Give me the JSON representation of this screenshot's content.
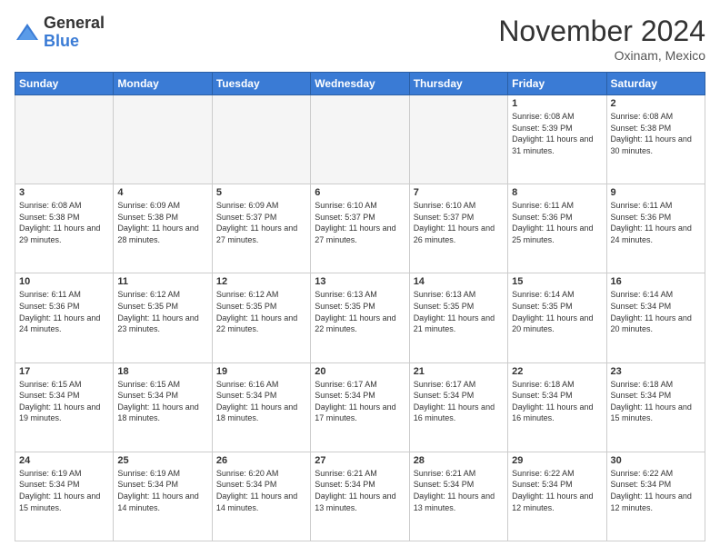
{
  "header": {
    "logo_general": "General",
    "logo_blue": "Blue",
    "month_title": "November 2024",
    "location": "Oxinam, Mexico"
  },
  "weekdays": [
    "Sunday",
    "Monday",
    "Tuesday",
    "Wednesday",
    "Thursday",
    "Friday",
    "Saturday"
  ],
  "weeks": [
    [
      {
        "day": "",
        "empty": true
      },
      {
        "day": "",
        "empty": true
      },
      {
        "day": "",
        "empty": true
      },
      {
        "day": "",
        "empty": true
      },
      {
        "day": "",
        "empty": true
      },
      {
        "day": "1",
        "sunrise": "6:08 AM",
        "sunset": "5:39 PM",
        "daylight": "11 hours and 31 minutes."
      },
      {
        "day": "2",
        "sunrise": "6:08 AM",
        "sunset": "5:38 PM",
        "daylight": "11 hours and 30 minutes."
      }
    ],
    [
      {
        "day": "3",
        "sunrise": "6:08 AM",
        "sunset": "5:38 PM",
        "daylight": "11 hours and 29 minutes."
      },
      {
        "day": "4",
        "sunrise": "6:09 AM",
        "sunset": "5:38 PM",
        "daylight": "11 hours and 28 minutes."
      },
      {
        "day": "5",
        "sunrise": "6:09 AM",
        "sunset": "5:37 PM",
        "daylight": "11 hours and 27 minutes."
      },
      {
        "day": "6",
        "sunrise": "6:10 AM",
        "sunset": "5:37 PM",
        "daylight": "11 hours and 27 minutes."
      },
      {
        "day": "7",
        "sunrise": "6:10 AM",
        "sunset": "5:37 PM",
        "daylight": "11 hours and 26 minutes."
      },
      {
        "day": "8",
        "sunrise": "6:11 AM",
        "sunset": "5:36 PM",
        "daylight": "11 hours and 25 minutes."
      },
      {
        "day": "9",
        "sunrise": "6:11 AM",
        "sunset": "5:36 PM",
        "daylight": "11 hours and 24 minutes."
      }
    ],
    [
      {
        "day": "10",
        "sunrise": "6:11 AM",
        "sunset": "5:36 PM",
        "daylight": "11 hours and 24 minutes."
      },
      {
        "day": "11",
        "sunrise": "6:12 AM",
        "sunset": "5:35 PM",
        "daylight": "11 hours and 23 minutes."
      },
      {
        "day": "12",
        "sunrise": "6:12 AM",
        "sunset": "5:35 PM",
        "daylight": "11 hours and 22 minutes."
      },
      {
        "day": "13",
        "sunrise": "6:13 AM",
        "sunset": "5:35 PM",
        "daylight": "11 hours and 22 minutes."
      },
      {
        "day": "14",
        "sunrise": "6:13 AM",
        "sunset": "5:35 PM",
        "daylight": "11 hours and 21 minutes."
      },
      {
        "day": "15",
        "sunrise": "6:14 AM",
        "sunset": "5:35 PM",
        "daylight": "11 hours and 20 minutes."
      },
      {
        "day": "16",
        "sunrise": "6:14 AM",
        "sunset": "5:34 PM",
        "daylight": "11 hours and 20 minutes."
      }
    ],
    [
      {
        "day": "17",
        "sunrise": "6:15 AM",
        "sunset": "5:34 PM",
        "daylight": "11 hours and 19 minutes."
      },
      {
        "day": "18",
        "sunrise": "6:15 AM",
        "sunset": "5:34 PM",
        "daylight": "11 hours and 18 minutes."
      },
      {
        "day": "19",
        "sunrise": "6:16 AM",
        "sunset": "5:34 PM",
        "daylight": "11 hours and 18 minutes."
      },
      {
        "day": "20",
        "sunrise": "6:17 AM",
        "sunset": "5:34 PM",
        "daylight": "11 hours and 17 minutes."
      },
      {
        "day": "21",
        "sunrise": "6:17 AM",
        "sunset": "5:34 PM",
        "daylight": "11 hours and 16 minutes."
      },
      {
        "day": "22",
        "sunrise": "6:18 AM",
        "sunset": "5:34 PM",
        "daylight": "11 hours and 16 minutes."
      },
      {
        "day": "23",
        "sunrise": "6:18 AM",
        "sunset": "5:34 PM",
        "daylight": "11 hours and 15 minutes."
      }
    ],
    [
      {
        "day": "24",
        "sunrise": "6:19 AM",
        "sunset": "5:34 PM",
        "daylight": "11 hours and 15 minutes."
      },
      {
        "day": "25",
        "sunrise": "6:19 AM",
        "sunset": "5:34 PM",
        "daylight": "11 hours and 14 minutes."
      },
      {
        "day": "26",
        "sunrise": "6:20 AM",
        "sunset": "5:34 PM",
        "daylight": "11 hours and 14 minutes."
      },
      {
        "day": "27",
        "sunrise": "6:21 AM",
        "sunset": "5:34 PM",
        "daylight": "11 hours and 13 minutes."
      },
      {
        "day": "28",
        "sunrise": "6:21 AM",
        "sunset": "5:34 PM",
        "daylight": "11 hours and 13 minutes."
      },
      {
        "day": "29",
        "sunrise": "6:22 AM",
        "sunset": "5:34 PM",
        "daylight": "11 hours and 12 minutes."
      },
      {
        "day": "30",
        "sunrise": "6:22 AM",
        "sunset": "5:34 PM",
        "daylight": "11 hours and 12 minutes."
      }
    ]
  ],
  "labels": {
    "sunrise": "Sunrise:",
    "sunset": "Sunset:",
    "daylight": "Daylight:"
  }
}
